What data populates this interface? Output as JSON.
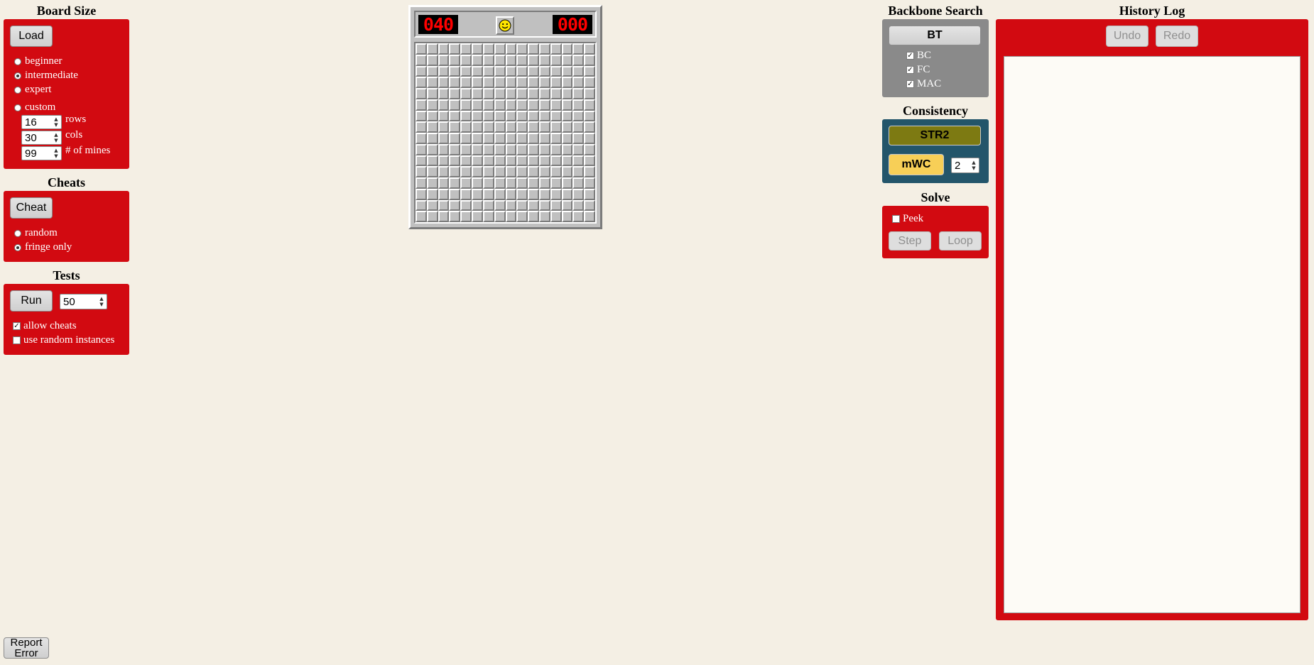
{
  "board_size": {
    "title": "Board Size",
    "load_label": "Load",
    "options": [
      "beginner",
      "intermediate",
      "expert",
      "custom"
    ],
    "selected": "intermediate",
    "rows": {
      "value": "16",
      "label": "rows"
    },
    "cols": {
      "value": "30",
      "label": "cols"
    },
    "mines": {
      "value": "99",
      "label": "# of mines"
    }
  },
  "cheats": {
    "title": "Cheats",
    "cheat_label": "Cheat",
    "options": [
      "random",
      "fringe only"
    ],
    "selected": "fringe only"
  },
  "tests": {
    "title": "Tests",
    "run_label": "Run",
    "count": "50",
    "allow_cheats": {
      "label": "allow cheats",
      "checked": true
    },
    "random_instances": {
      "label": "use random instances",
      "checked": false
    }
  },
  "game": {
    "mines_counter": "040",
    "timer": "000",
    "grid_rows": 16,
    "grid_cols": 16
  },
  "backbone": {
    "title": "Backbone Search",
    "bt_label": "BT",
    "options": [
      {
        "label": "BC",
        "checked": true
      },
      {
        "label": "FC",
        "checked": true
      },
      {
        "label": "MAC",
        "checked": true
      }
    ]
  },
  "consistency": {
    "title": "Consistency",
    "str2_label": "STR2",
    "mwc_label": "mWC",
    "mwc_value": "2"
  },
  "solve": {
    "title": "Solve",
    "peek_label": "Peek",
    "peek_checked": false,
    "step_label": "Step",
    "loop_label": "Loop"
  },
  "history": {
    "title": "History Log",
    "undo_label": "Undo",
    "redo_label": "Redo"
  },
  "report_error": {
    "line1": "Report",
    "line2": "Error"
  },
  "colors": {
    "background": "#f4efe4",
    "panel_red": "#d20a11",
    "backbone_gray": "#8a8a8a",
    "consistency_teal": "#23556a",
    "str2_olive": "#7d7a12",
    "mwc_yellow": "#f7cf57"
  }
}
